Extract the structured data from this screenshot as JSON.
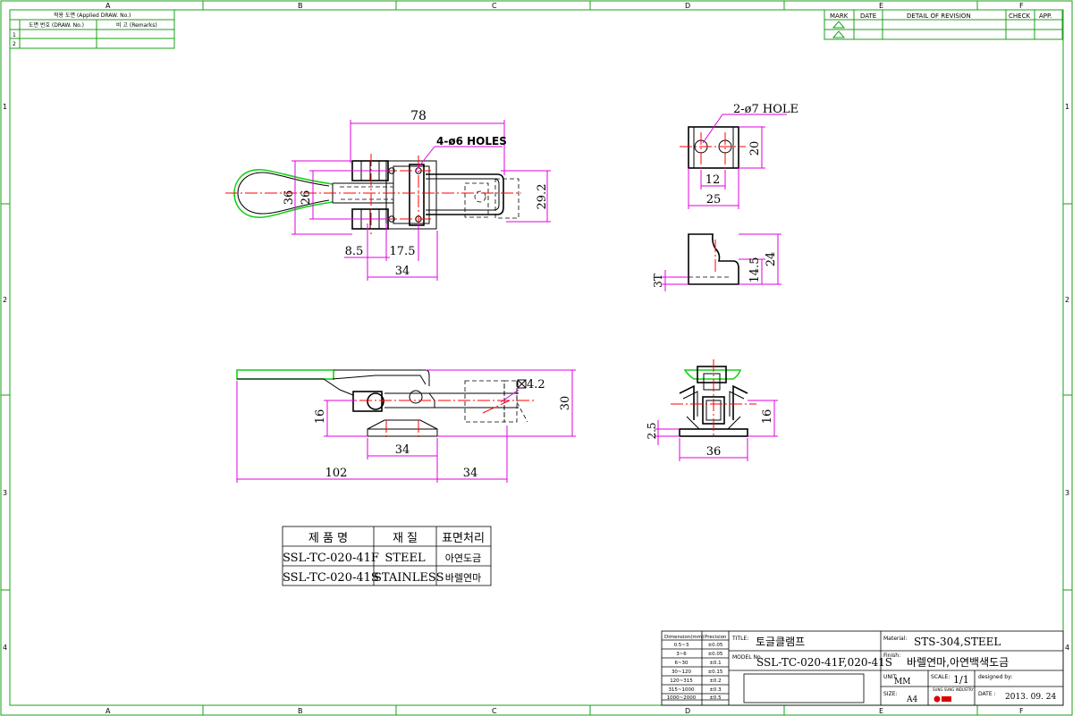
{
  "zone_letters": [
    "A",
    "B",
    "C",
    "D",
    "E",
    "F"
  ],
  "zone_numbers": [
    "1",
    "2",
    "3",
    "4"
  ],
  "ref_table": {
    "header_top": "적용 도면 (Applied DRAW. No.)",
    "col1": "도면 번호 (DRAW. No.)",
    "col2": "비 고 (Remarks)",
    "rows": [
      "1",
      "2"
    ]
  },
  "revision_table": {
    "headers": [
      "MARK",
      "DATE",
      "DETAIL OF REVISION",
      "CHECK",
      "APP."
    ]
  },
  "dimensions": {
    "top_width": "78",
    "holes_4": "4-ø6  HOLES",
    "height_36": "36",
    "height_26": "26",
    "height_292": "29.2",
    "d_85": "8.5",
    "d_175": "17.5",
    "d_34a": "34",
    "holes_2": "2-ø7 HOLE",
    "h_20": "20",
    "w_12": "12",
    "w_25": "25",
    "t_3": "3T",
    "h_145": "14.5",
    "h_24": "24",
    "sq_42": "4.2",
    "h_16": "16",
    "h_30": "30",
    "d_34b": "34",
    "d_102": "102",
    "d_34c": "34",
    "h_25": "2.5",
    "h_16b": "16",
    "w_36": "36"
  },
  "spec_table": {
    "headers": [
      "제 품 명",
      "재 질",
      "표면처리"
    ],
    "rows": [
      [
        "SSL-TC-020-41F",
        "STEEL",
        "아연도금"
      ],
      [
        "SSL-TC-020-41S",
        "STAINLESS",
        "바렐연마"
      ]
    ]
  },
  "title_block": {
    "tol_header_dim": "Dimension(mm)",
    "tol_header_prec": "Precision",
    "tolerances": [
      [
        "0.5~3",
        "±0.05"
      ],
      [
        "3~6",
        "±0.05"
      ],
      [
        "6~30",
        "±0.1"
      ],
      [
        "30~120",
        "±0.15"
      ],
      [
        "120~315",
        "±0.2"
      ],
      [
        "315~1000",
        "±0.3"
      ],
      [
        "1000~2000",
        "±0.5"
      ]
    ],
    "title_label": "TITLE:",
    "title": "토글클램프",
    "material_label": "Material:",
    "material": "STS-304,STEEL",
    "model_label": "MODEL No.",
    "model": "SSL-TC-020-41F,020-41S",
    "finish_label": "Finish:",
    "finish": "바렐연마,아연백색도금",
    "unit_label": "UNIT:",
    "unit": "MM",
    "scale_label": "SCALE:",
    "scale": "1/1",
    "designed_label": "designed by:",
    "size_label": "SIZE:",
    "size": "A4",
    "date_label": "DATE :",
    "date": "2013. 09. 24",
    "logo_text": "SUNG SUNG INDUSTRY"
  }
}
